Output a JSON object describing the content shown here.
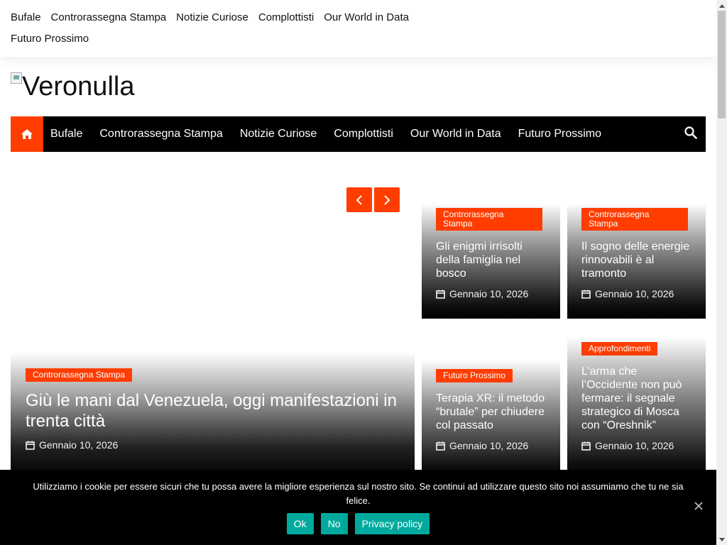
{
  "top_menu": {
    "items": [
      "Bufale",
      "Controrassegna Stampa",
      "Notizie Curiose",
      "Complottisti",
      "Our World in Data",
      "Futuro Prossimo"
    ]
  },
  "logo": {
    "alt_text": "Veronulla"
  },
  "main_nav": {
    "home_icon": "home-icon",
    "items": [
      "Bufale",
      "Controrassegna Stampa",
      "Notizie Curiose",
      "Complottisti",
      "Our World in Data",
      "Futuro Prossimo"
    ],
    "search_icon": "search-icon"
  },
  "slider": {
    "prev_icon": "chevron-left-icon",
    "next_icon": "chevron-right-icon"
  },
  "featured": {
    "category": "Controrassegna Stampa",
    "title": "Giù le mani dal Venezuela, oggi manifestazioni in trenta città",
    "date": "Gennaio 10, 2026"
  },
  "cards": [
    {
      "category": "Controrassegna Stampa",
      "title": "Gli enigmi irrisolti della famiglia nel bosco",
      "date": "Gennaio 10, 2026"
    },
    {
      "category": "Controrassegna Stampa",
      "title": "Il sogno delle energie rinnovabili è al tramonto",
      "date": "Gennaio 10, 2026"
    },
    {
      "category": "Futuro Prossimo",
      "title": "Terapia XR: il metodo “brutale” per chiudere col passato",
      "date": "Gennaio 10, 2026"
    },
    {
      "category": "Approfondimenti",
      "title": "L’arma che l’Occidente non può fermare: il segnale strategico di Mosca con “Oreshnik”",
      "date": "Gennaio 10, 2026"
    }
  ],
  "cookie_banner": {
    "text": "Utilizziamo i cookie per essere sicuri che tu possa avere la migliore esperienza sul nostro sito. Se continui ad utilizzare questo sito noi assumiamo che tu ne sia felice.",
    "ok_label": "Ok",
    "no_label": "No",
    "privacy_label": "Privacy policy",
    "close_icon": "close-icon"
  },
  "colors": {
    "accent": "#ff3d00",
    "nav_bg": "#000000",
    "cookie_button": "#00a99d"
  }
}
